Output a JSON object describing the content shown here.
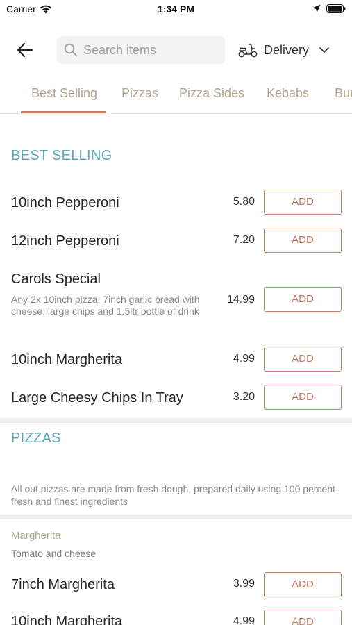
{
  "status_bar": {
    "carrier": "Carrier",
    "time": "1:34 PM"
  },
  "header": {
    "search_placeholder": "Search items",
    "delivery_label": "Delivery"
  },
  "tabs": [
    {
      "label": "Best Selling",
      "active": true
    },
    {
      "label": "Pizzas"
    },
    {
      "label": "Pizza Sides"
    },
    {
      "label": "Kebabs"
    },
    {
      "label": "Bur"
    }
  ],
  "sections": {
    "best_selling": {
      "title": "BEST SELLING",
      "items": [
        {
          "name": "10inch Pepperoni",
          "price": "5.80",
          "button": "ADD"
        },
        {
          "name": "12inch Pepperoni",
          "price": "7.20",
          "button": "ADD"
        },
        {
          "name": "Carols Special",
          "description": "Any 2x 10inch pizza, 7inch garlic bread with cheese, large chips and 1.5ltr bottle of drink",
          "price": "14.99",
          "button": "ADD"
        },
        {
          "name": "10inch Margherita",
          "price": "4.99",
          "button": "ADD"
        },
        {
          "name": "Large Cheesy Chips In Tray",
          "price": "3.20",
          "button": "ADD"
        }
      ]
    },
    "pizzas": {
      "title": "PIZZAS",
      "note": "All out pizzas are made from fresh dough, prepared daily using 100 percent fresh and finest ingredients",
      "group": {
        "heading": "Margherita",
        "description": "Tomato and cheese"
      },
      "items": [
        {
          "name": "7inch Margherita",
          "price": "3.99",
          "button": "ADD"
        },
        {
          "name": "10inch Margherita",
          "price": "4.99",
          "button": "ADD"
        }
      ]
    }
  },
  "colors": {
    "accent": "#c27a62",
    "section_title": "#5aa6b8",
    "tab_text": "#b0a68e"
  }
}
